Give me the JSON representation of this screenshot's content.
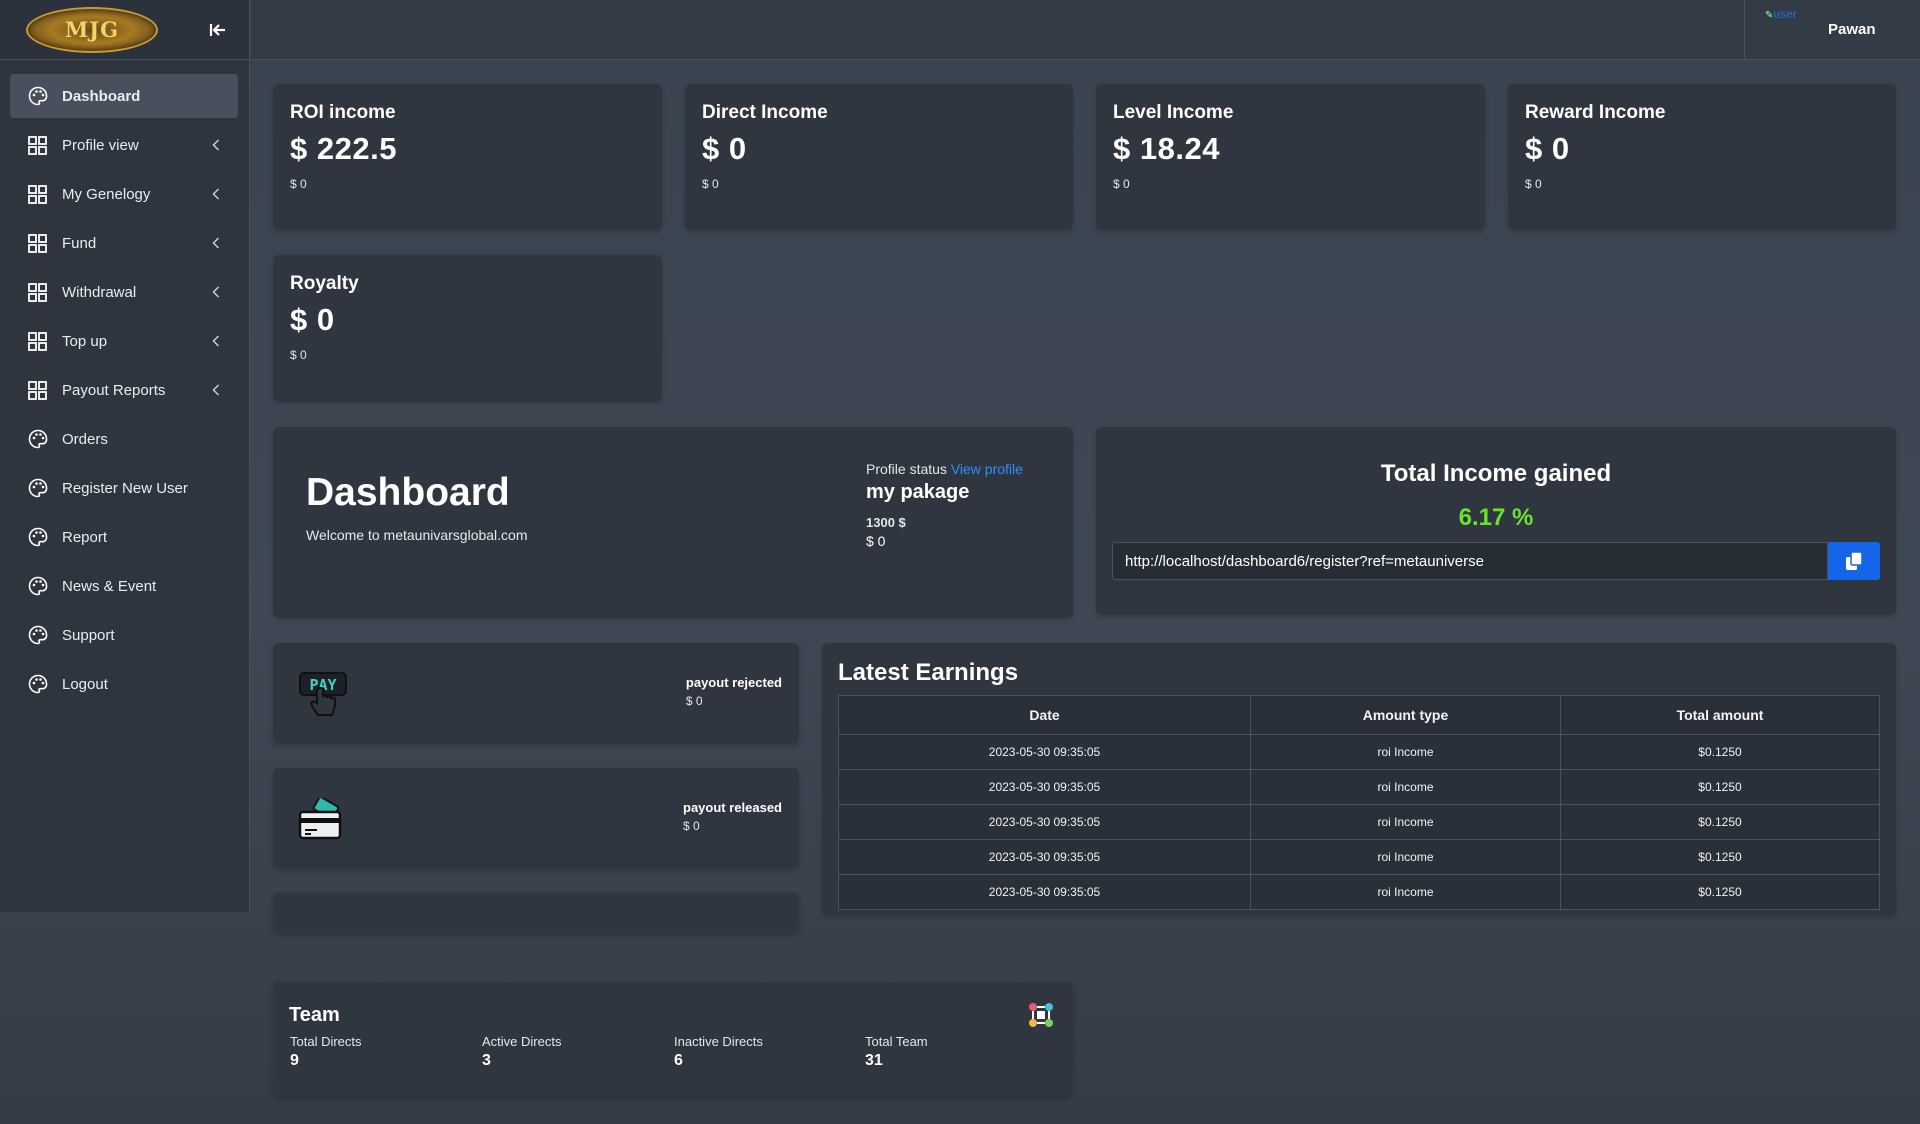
{
  "brand": {
    "logo_text": "MJG"
  },
  "sidebar": {
    "items": [
      {
        "label": "Dashboard",
        "icon": "palette-icon",
        "submenu": false,
        "active": true
      },
      {
        "label": "Profile view",
        "icon": "grid-icon",
        "submenu": true
      },
      {
        "label": "My Genelogy",
        "icon": "grid-icon",
        "submenu": true
      },
      {
        "label": "Fund",
        "icon": "grid-icon",
        "submenu": true
      },
      {
        "label": "Withdrawal",
        "icon": "grid-icon",
        "submenu": true
      },
      {
        "label": "Top up",
        "icon": "grid-icon",
        "submenu": true
      },
      {
        "label": "Payout Reports",
        "icon": "grid-icon",
        "submenu": true
      },
      {
        "label": "Orders",
        "icon": "palette-icon",
        "submenu": false
      },
      {
        "label": "Register New User",
        "icon": "palette-icon",
        "submenu": false
      },
      {
        "label": "Report",
        "icon": "palette-icon",
        "submenu": false
      },
      {
        "label": "News & Event",
        "icon": "palette-icon",
        "submenu": false
      },
      {
        "label": "Support",
        "icon": "palette-icon",
        "submenu": false
      },
      {
        "label": "Logout",
        "icon": "palette-icon",
        "submenu": false
      }
    ]
  },
  "header": {
    "user_image_alt": "user",
    "user_name": "Pawan"
  },
  "stats": [
    {
      "title": "ROI income",
      "value": "$ 222.5",
      "sub": "$ 0"
    },
    {
      "title": "Direct Income",
      "value": "$ 0",
      "sub": "$ 0"
    },
    {
      "title": "Level Income",
      "value": "$ 18.24",
      "sub": "$ 0"
    },
    {
      "title": "Reward Income",
      "value": "$ 0",
      "sub": "$ 0"
    },
    {
      "title": "Royalty",
      "value": "$ 0",
      "sub": "$ 0"
    }
  ],
  "dashboard": {
    "title": "Dashboard",
    "welcome": "Welcome to metaunivarsglobal.com",
    "profile_status_label": "Profile status",
    "view_profile_link": "View profile",
    "package_title": "my pakage",
    "package_amount": "1300 $",
    "package_sub": "$ 0"
  },
  "income": {
    "title": "Total Income gained",
    "percent": "6.17 %",
    "ref_link": "http://localhost/dashboard6/register?ref=metauniverse"
  },
  "payouts": {
    "rejected_label": "payout rejected",
    "rejected_amount": "$ 0",
    "released_label": "payout released",
    "released_amount": "$ 0",
    "pay_icon_text": "PAY"
  },
  "earnings": {
    "title": "Latest Earnings",
    "columns": [
      "Date",
      "Amount type",
      "Total amount"
    ],
    "rows": [
      [
        "2023-05-30 09:35:05",
        "roi Income",
        "$0.1250"
      ],
      [
        "2023-05-30 09:35:05",
        "roi Income",
        "$0.1250"
      ],
      [
        "2023-05-30 09:35:05",
        "roi Income",
        "$0.1250"
      ],
      [
        "2023-05-30 09:35:05",
        "roi Income",
        "$0.1250"
      ],
      [
        "2023-05-30 09:35:05",
        "roi Income",
        "$0.1250"
      ]
    ]
  },
  "team": {
    "title": "Team",
    "stats": [
      {
        "label": "Total Directs",
        "value": "9"
      },
      {
        "label": "Active Directs",
        "value": "3"
      },
      {
        "label": "Inactive Directs",
        "value": "6"
      },
      {
        "label": "Total Team",
        "value": "31"
      }
    ]
  },
  "colors": {
    "accent_blue": "#1565e8",
    "link_blue": "#2f8cff",
    "percent_green": "#6be22c",
    "card_bg": "#2f3640",
    "sidebar_bg": "#2e353f"
  }
}
